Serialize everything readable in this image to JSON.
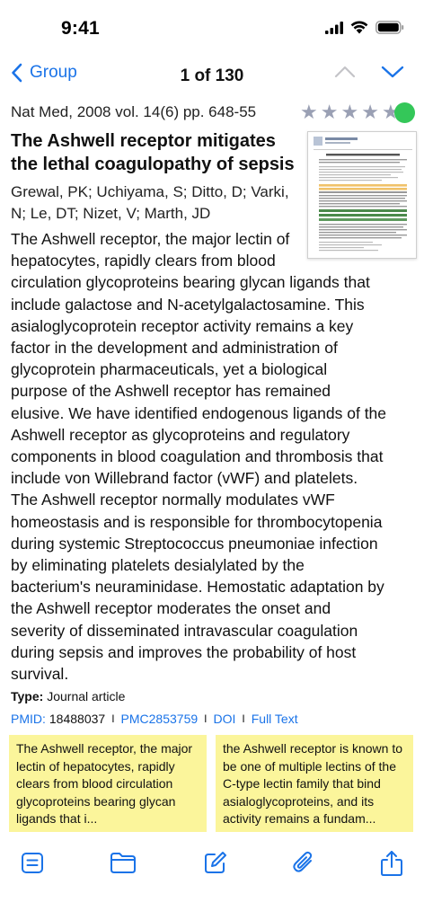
{
  "status_bar": {
    "time": "9:41"
  },
  "nav": {
    "back_label": "Group",
    "position": "1 of 130"
  },
  "article": {
    "citation": "Nat Med, 2008 vol. 14(6) pp. 648-55",
    "rating": {
      "stars": 5,
      "filled": 0
    },
    "status_color": "#34c759",
    "title": "The Ashwell receptor mitigates the lethal coagulopathy of sepsis",
    "authors": "Grewal, PK; Uchiyama, S; Ditto, D; Varki, N; Le, DT; Nizet, V; Marth, JD",
    "abstract_lines": [
      "The Ashwell receptor, the major lectin of",
      "hepatocytes, rapidly clears from blood",
      "circulation glycoproteins bearing glycan ligands that",
      "include galactose and N-acetylgalactosamine. This",
      "asialoglycoprotein receptor activity remains a key",
      "factor in the development and administration of",
      "glycoprotein pharmaceuticals, yet a biological",
      "purpose of the Ashwell receptor has remained",
      "elusive. We have identified endogenous ligands of the",
      "Ashwell receptor as glycoproteins and regulatory",
      "components in blood coagulation and thrombosis that",
      "include von Willebrand factor (vWF) and platelets.",
      "The Ashwell receptor normally modulates vWF",
      "homeostasis and is responsible for thrombocytopenia",
      "during systemic Streptococcus pneumoniae infection",
      "by eliminating platelets desialylated by the",
      "bacterium's neuraminidase. Hemostatic adaptation by",
      "the Ashwell receptor moderates the onset and",
      "severity of disseminated intravascular coagulation",
      "during sepsis and improves the probability of host",
      "survival."
    ],
    "type_label": "Type:",
    "type_value": "Journal article",
    "pmid_label": "PMID:",
    "pmid_value": "18488037",
    "pmc": "PMC2853759",
    "doi": "DOI",
    "full_text": "Full Text",
    "separator": "I"
  },
  "highlights": [
    {
      "text": "The Ashwell receptor, the major lectin of hepatocytes, rapidly clears from blood circulation glycoproteins bearing glycan ligands that i..."
    },
    {
      "text": "the Ashwell receptor is known to be one of multiple lectins of the C-type lectin family that bind asialoglycoproteins, and its activity remains a fundam..."
    }
  ],
  "toolbar": {
    "icons": [
      "notes-icon",
      "folder-icon",
      "edit-icon",
      "paperclip-icon",
      "share-icon"
    ]
  },
  "colors": {
    "accent": "#1a73e8",
    "highlight": "#fbf59b",
    "star": "#9aa0b4"
  }
}
